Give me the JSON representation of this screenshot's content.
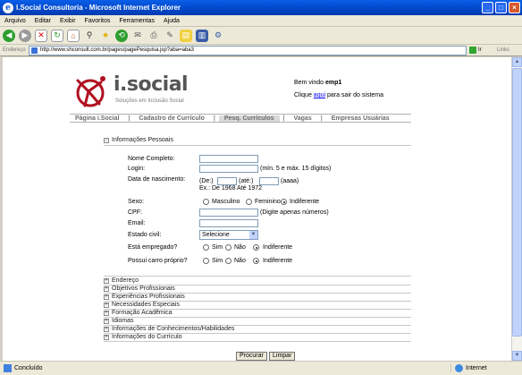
{
  "window": {
    "title": "I.Social Consultoria - Microsoft Internet Explorer"
  },
  "menu": [
    "Arquivo",
    "Editar",
    "Exibir",
    "Favoritos",
    "Ferramentas",
    "Ajuda"
  ],
  "address": {
    "label": "Endereço",
    "url": "http://www.shconsult.com.br/pages/pagePesquisa.jsp?aba=aba3",
    "go": "Ir",
    "links": "Links"
  },
  "brand": {
    "name": "i.social",
    "tagline": "Soluções em Inclusão Social"
  },
  "welcome": {
    "prefix": "Bem vindo ",
    "user": "emp1",
    "click": "Clique ",
    "here": "aqui",
    "suffix": " para sair do sistema"
  },
  "nav": [
    {
      "label": "Página i.Social"
    },
    {
      "label": "Cadastro de Currículo"
    },
    {
      "label": "Pesq. Currículos",
      "active": true
    },
    {
      "label": "Vagas"
    },
    {
      "label": "Empresas Usuárias"
    }
  ],
  "personal": {
    "header": "Informações Pessoais",
    "name_label": "Nome Completo:",
    "login_label": "Login:",
    "login_hint": "(mín. 5 e máx. 15 dígitos)",
    "birth_label": "Data de nascimento:",
    "birth_from": "(De:)",
    "birth_to": "(até:)",
    "birth_fmt": "(aaaa)",
    "birth_example": "Ex.: De 1968 Até 1972",
    "sex_label": "Sexo:",
    "sex_options": [
      "Masculino",
      "Feminino",
      "Indiferente"
    ],
    "sex_selected": "Indiferente",
    "cpf_label": "CPF:",
    "cpf_hint": "(Digite apenas números)",
    "email_label": "Email:",
    "civil_label": "Estado civil:",
    "civil_value": "Selecione",
    "employed_label": "Está empregado?",
    "employed_options": [
      "Sim",
      "Não",
      "Indiferente"
    ],
    "employed_selected": "Indiferente",
    "car_label": "Possui carro próprio?",
    "car_options": [
      "Sim",
      "Não",
      "Indiferente"
    ],
    "car_selected": "Indiferente"
  },
  "sections": [
    "Endereço",
    "Objetivos Profissionais",
    "Experiências Profissionais",
    "Necessidades Especiais",
    "Formação Acadêmica",
    "Idiomas",
    "Informações de Conhecimentos/Habilidades",
    "Informações do Currículo"
  ],
  "buttons": {
    "search": "Procurar",
    "clear": "Limpar"
  },
  "status": {
    "left": "Concluído",
    "zone": "Internet"
  }
}
